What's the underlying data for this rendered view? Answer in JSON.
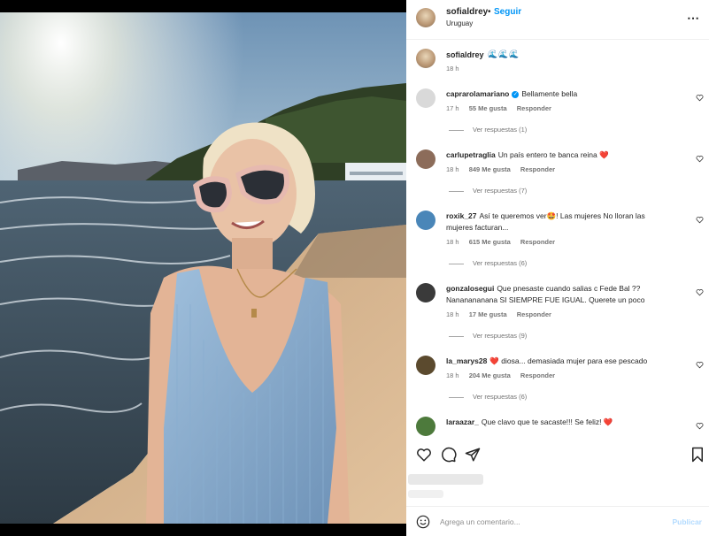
{
  "post": {
    "username": "sofialdrey",
    "separator": "•",
    "follow_label": "Seguir",
    "location": "Uruguay",
    "caption_emoji": "🌊🌊🌊",
    "caption_time": "18 h"
  },
  "comments": [
    {
      "user": "caprarolamariano",
      "verified": true,
      "text": "Bellamente bella",
      "time": "17 h",
      "likes": "55 Me gusta",
      "reply": "Responder",
      "view_replies": "Ver respuestas (1)",
      "avatar_color": "#d9d9d9"
    },
    {
      "user": "carlupetraglia",
      "verified": false,
      "text": "Un país entero te banca reina ❤️",
      "time": "18 h",
      "likes": "849 Me gusta",
      "reply": "Responder",
      "view_replies": "Ver respuestas (7)",
      "avatar_color": "#8c6c5a"
    },
    {
      "user": "roxik_27",
      "verified": false,
      "text": "Así te queremos ver🤩! Las mujeres No lloran las mujeres facturan...",
      "time": "18 h",
      "likes": "615 Me gusta",
      "reply": "Responder",
      "view_replies": "Ver respuestas (6)",
      "avatar_color": "#4a86b8"
    },
    {
      "user": "gonzalosegui",
      "verified": false,
      "text": "Que pnesaste cuando salias c Fede Bal ?? Nananananana SI SIEMPRE FUE IGUAL. Querete un poco",
      "time": "18 h",
      "likes": "17 Me gusta",
      "reply": "Responder",
      "view_replies": "Ver respuestas (9)",
      "avatar_color": "#3a3a3a"
    },
    {
      "user": "la_marys28",
      "verified": false,
      "text": "❤️ diosa... demasiada mujer para ese pescado",
      "time": "18 h",
      "likes": "204 Me gusta",
      "reply": "Responder",
      "view_replies": "Ver respuestas (6)",
      "avatar_color": "#5b4a2e"
    },
    {
      "user": "laraazar_",
      "verified": false,
      "text": "Que clavo que te sacaste!!! Se feliz! ❤️",
      "time": "",
      "likes": "",
      "reply": "",
      "view_replies": "",
      "avatar_color": "#4d7a3c"
    }
  ],
  "composer": {
    "placeholder": "Agrega un comentario...",
    "publish_label": "Publicar"
  },
  "icons": {
    "more": "more-horizontal-icon",
    "like": "heart-icon",
    "comment": "comment-bubble-icon",
    "share": "paper-plane-icon",
    "save": "bookmark-icon",
    "emoji": "smiley-icon"
  },
  "colors": {
    "link": "#0095f6",
    "secondary_text": "#737373",
    "publish_disabled": "#b3dbff"
  }
}
